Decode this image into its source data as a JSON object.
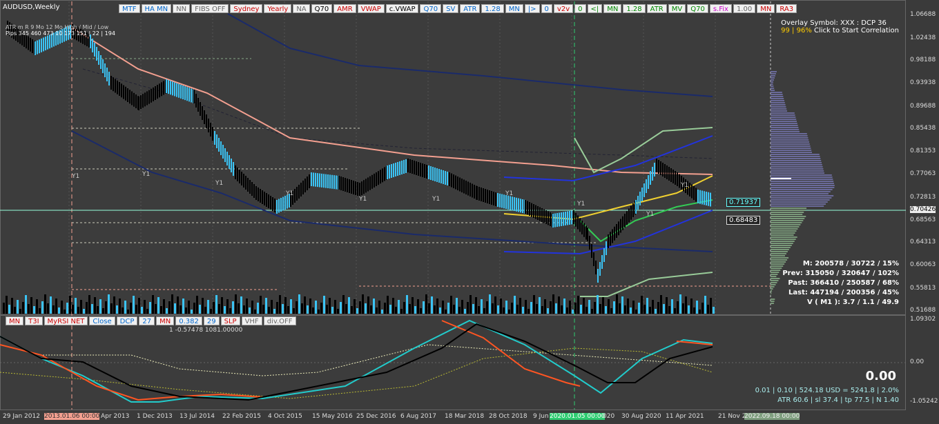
{
  "symbol": "AUDUSD,Weekly",
  "toolbar": [
    "MTF",
    "HA MN",
    "NN",
    "FIBS OFF",
    "Sydney",
    "Yearly",
    "NA",
    "Q70",
    "AMR",
    "VWAP",
    "c.VWAP",
    "Q70",
    "SV",
    "ATR",
    "1.28",
    "MN",
    "|>",
    "0",
    "v2v",
    "0",
    "<|",
    "MN",
    "1.28",
    "ATR",
    "MV",
    "Q70",
    "s.Fix",
    "1.00",
    "MN",
    "RA3"
  ],
  "toolbar_colors": [
    "#06c",
    "#06c",
    "#666",
    "#666",
    "#c00",
    "#c00",
    "#666",
    "#000",
    "#c00",
    "#c00",
    "#000",
    "#06c",
    "#06c",
    "#06c",
    "#06c",
    "#06c",
    "#06c",
    "#06c",
    "#c00",
    "#080",
    "#080",
    "#080",
    "#080",
    "#080",
    "#080",
    "#080",
    "#c0c",
    "#666",
    "#c00",
    "#c00"
  ],
  "toolbar2": [
    "MN",
    "T3I",
    "MyRSI NET",
    "Close",
    "DCP",
    "27",
    "MN",
    "0.382",
    "29",
    "SLP",
    "VHF",
    "div.OFF"
  ],
  "toolbar2_colors": [
    "#c00",
    "#c00",
    "#c00",
    "#06c",
    "#06c",
    "#06c",
    "#c00",
    "#06c",
    "#06c",
    "#c00",
    "#666",
    "#666"
  ],
  "stats_tl": {
    "line1": "ATR  m  R         9 Mo    12 Mo      High / Mid / Low",
    "line2": "Pips  345  460  473   10    173        151  |  22  |  194"
  },
  "info_tr": {
    "line1": "Overlay Symbol: XXX : DCP 36",
    "line2_a": "99 | 96%",
    "line2_b": " Click to Start Correlation"
  },
  "info_br": {
    "m": "M: 200578 / 30722 / 15%",
    "prev": "Prev: 315050 / 320647 / 102%",
    "past": "Past: 366410 / 250587 / 68%",
    "last": "Last: 447194 / 200356 / 45%",
    "v": "V ( M1 ): 3.7 / 1.1 / 49.9"
  },
  "sub_label": "1 -0.57478 1081.00000",
  "big_value": "0.00",
  "info_br2": {
    "line1": "0.01  |  0.10  |  524.18 USD = 5241.8  |  2.0%",
    "line2": "ATR 60.6  | sl 37.4  |  tp 77.5  |  N 1.40"
  },
  "price_ticks": [
    "1.06688",
    "1.02438",
    "0.98188",
    "0.93938",
    "0.89688",
    "0.85438",
    "0.81353",
    "0.77063",
    "0.72813",
    "0.70426",
    "0.68563",
    "0.64313",
    "0.60063",
    "0.55813",
    "0.51688"
  ],
  "price_tick_y": [
    22,
    56,
    88,
    121,
    155,
    187,
    220,
    253,
    287,
    305,
    320,
    352,
    385,
    419,
    451
  ],
  "sub_ticks": [
    "1.09302",
    "0.00",
    "-1.05242"
  ],
  "price_box_a": "0.71937",
  "price_box_b": "0.68483",
  "time_ticks": [
    "29 Jan 2012",
    "2013.01.06 00:00",
    "Apr 2013",
    "1 Dec 2013",
    "13 Jul 2014",
    "22 Feb 2015",
    "4 Oct 2015",
    "15 May 2016",
    "25 Dec 2016",
    "6 Aug 2017",
    "18 Mar 2018",
    "28 Oct 2018",
    "9 Jun",
    "2020.01.05 00:00",
    "020",
    "30 Aug 2020",
    "11 Apr 2021",
    "21 Nov 202",
    "2022.09.18 00:00"
  ],
  "y1_labels": [
    "Y1",
    "Y1",
    "Y1",
    "Y1",
    "Y1",
    "Y1",
    "Y1",
    "Y1",
    "Y1",
    "Y1"
  ]
}
